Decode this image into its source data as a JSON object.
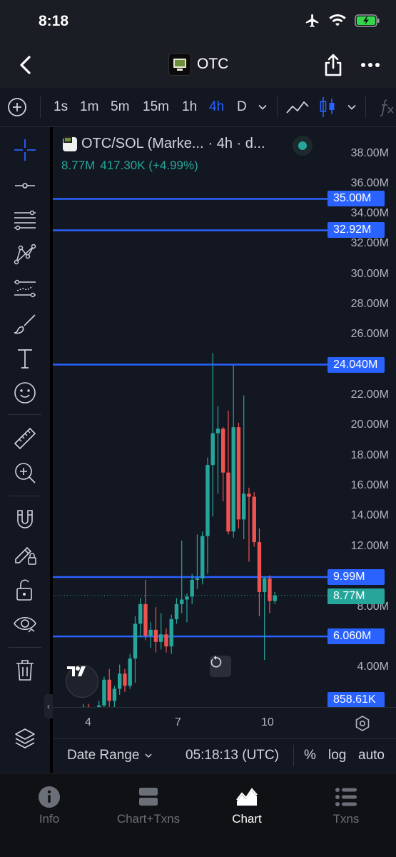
{
  "status_bar": {
    "time": "8:18"
  },
  "nav": {
    "title": "OTC"
  },
  "timeframes": {
    "items": [
      "1s",
      "1m",
      "5m",
      "15m",
      "1h",
      "4h",
      "D"
    ],
    "active": "4h"
  },
  "chart": {
    "symbol": "OTC/SOL (Marke...",
    "interval_info": "· 4h · d...",
    "stat_open": "8.77M",
    "stat_change": "417.30K (+4.99%)",
    "price_scale": [
      "38.00M",
      "36.00M",
      "34.00M",
      "32.00M",
      "30.00M",
      "28.00M",
      "26.00M",
      "22.00M",
      "20.00M",
      "18.00M",
      "16.00M",
      "14.00M",
      "12.00M",
      "8.00M",
      "4.00M"
    ],
    "horizontal_lines": [
      {
        "label": "35.00M",
        "value": 35.0
      },
      {
        "label": "32.92M",
        "value": 32.92
      },
      {
        "label": "24.040M",
        "value": 24.04
      },
      {
        "label": "9.99M",
        "value": 9.99
      },
      {
        "label": "6.060M",
        "value": 6.06
      }
    ],
    "last_price": "8.77M",
    "volume_tag": "858.61K",
    "time_labels": [
      "4",
      "7",
      "10"
    ],
    "colors": {
      "up": "#26a69a",
      "down": "#ef5350",
      "hline": "#2962ff"
    }
  },
  "chart_data": {
    "type": "candlestick",
    "title": "OTC/SOL",
    "interval": "4h",
    "ylim": [
      0,
      39
    ],
    "candles": [
      {
        "o": 0.6,
        "h": 0.9,
        "l": 0.2,
        "c": 0.5
      },
      {
        "o": 0.5,
        "h": 0.8,
        "l": 0.2,
        "c": 0.4
      },
      {
        "o": 0.4,
        "h": 0.7,
        "l": 0.1,
        "c": 0.3
      },
      {
        "o": 0.3,
        "h": 0.6,
        "l": 0.1,
        "c": 0.5
      },
      {
        "o": 0.5,
        "h": 0.8,
        "l": 0.1,
        "c": 0.3
      },
      {
        "o": 0.3,
        "h": 1.6,
        "l": 0.2,
        "c": 1.4
      },
      {
        "o": 1.4,
        "h": 1.6,
        "l": 0.3,
        "c": 0.6
      },
      {
        "o": 0.6,
        "h": 0.9,
        "l": 0.1,
        "c": 0.4
      },
      {
        "o": 0.4,
        "h": 1.8,
        "l": 0.3,
        "c": 1.5
      },
      {
        "o": 1.5,
        "h": 3.4,
        "l": 1.0,
        "c": 3.2
      },
      {
        "o": 3.2,
        "h": 3.9,
        "l": 1.4,
        "c": 1.8
      },
      {
        "o": 1.8,
        "h": 2.8,
        "l": 1.0,
        "c": 2.6
      },
      {
        "o": 2.6,
        "h": 4.2,
        "l": 2.2,
        "c": 3.6
      },
      {
        "o": 3.6,
        "h": 3.9,
        "l": 2.4,
        "c": 2.8
      },
      {
        "o": 2.8,
        "h": 4.9,
        "l": 2.6,
        "c": 4.6
      },
      {
        "o": 4.6,
        "h": 7.4,
        "l": 3.0,
        "c": 6.9
      },
      {
        "o": 6.9,
        "h": 8.6,
        "l": 6.0,
        "c": 8.2
      },
      {
        "o": 8.2,
        "h": 9.8,
        "l": 5.8,
        "c": 6.1
      },
      {
        "o": 6.1,
        "h": 7.0,
        "l": 5.3,
        "c": 6.5
      },
      {
        "o": 6.5,
        "h": 8.0,
        "l": 5.0,
        "c": 5.7
      },
      {
        "o": 5.7,
        "h": 7.6,
        "l": 5.2,
        "c": 6.2
      },
      {
        "o": 6.2,
        "h": 6.6,
        "l": 5.0,
        "c": 5.4
      },
      {
        "o": 5.4,
        "h": 7.5,
        "l": 4.9,
        "c": 7.2
      },
      {
        "o": 7.2,
        "h": 8.6,
        "l": 6.9,
        "c": 8.2
      },
      {
        "o": 8.2,
        "h": 12.4,
        "l": 7.6,
        "c": 8.5
      },
      {
        "o": 8.5,
        "h": 8.9,
        "l": 7.0,
        "c": 8.7
      },
      {
        "o": 8.7,
        "h": 10.2,
        "l": 8.2,
        "c": 9.8
      },
      {
        "o": 9.8,
        "h": 12.8,
        "l": 9.2,
        "c": 9.9
      },
      {
        "o": 9.9,
        "h": 13.0,
        "l": 9.5,
        "c": 12.7
      },
      {
        "o": 12.7,
        "h": 17.9,
        "l": 10.2,
        "c": 17.4
      },
      {
        "o": 17.4,
        "h": 24.8,
        "l": 14.0,
        "c": 19.5
      },
      {
        "o": 19.5,
        "h": 21.3,
        "l": 15.5,
        "c": 19.8
      },
      {
        "o": 19.8,
        "h": 19.9,
        "l": 15.0,
        "c": 16.9
      },
      {
        "o": 16.9,
        "h": 21.0,
        "l": 12.8,
        "c": 13.0
      },
      {
        "o": 13.0,
        "h": 24.0,
        "l": 12.6,
        "c": 19.9
      },
      {
        "o": 19.9,
        "h": 20.2,
        "l": 13.2,
        "c": 13.8
      },
      {
        "o": 13.8,
        "h": 22.0,
        "l": 12.5,
        "c": 15.5
      },
      {
        "o": 15.5,
        "h": 15.9,
        "l": 11.0,
        "c": 15.3
      },
      {
        "o": 15.3,
        "h": 15.6,
        "l": 12.0,
        "c": 12.3
      },
      {
        "o": 12.3,
        "h": 13.2,
        "l": 7.4,
        "c": 9.0
      },
      {
        "o": 9.0,
        "h": 10.0,
        "l": 4.5,
        "c": 9.9
      },
      {
        "o": 9.9,
        "h": 10.1,
        "l": 7.6,
        "c": 8.4
      },
      {
        "o": 8.4,
        "h": 9.0,
        "l": 8.2,
        "c": 8.77
      }
    ]
  },
  "bottom_bar": {
    "date_range": "Date Range",
    "clock": "05:18:13 (UTC)",
    "percent": "%",
    "log": "log",
    "auto": "auto"
  },
  "tabs": [
    {
      "label": "Info",
      "icon": "info-icon"
    },
    {
      "label": "Chart+Txns",
      "icon": "split-view-icon"
    },
    {
      "label": "Chart",
      "icon": "chart-icon",
      "active": true
    },
    {
      "label": "Txns",
      "icon": "list-icon"
    }
  ]
}
